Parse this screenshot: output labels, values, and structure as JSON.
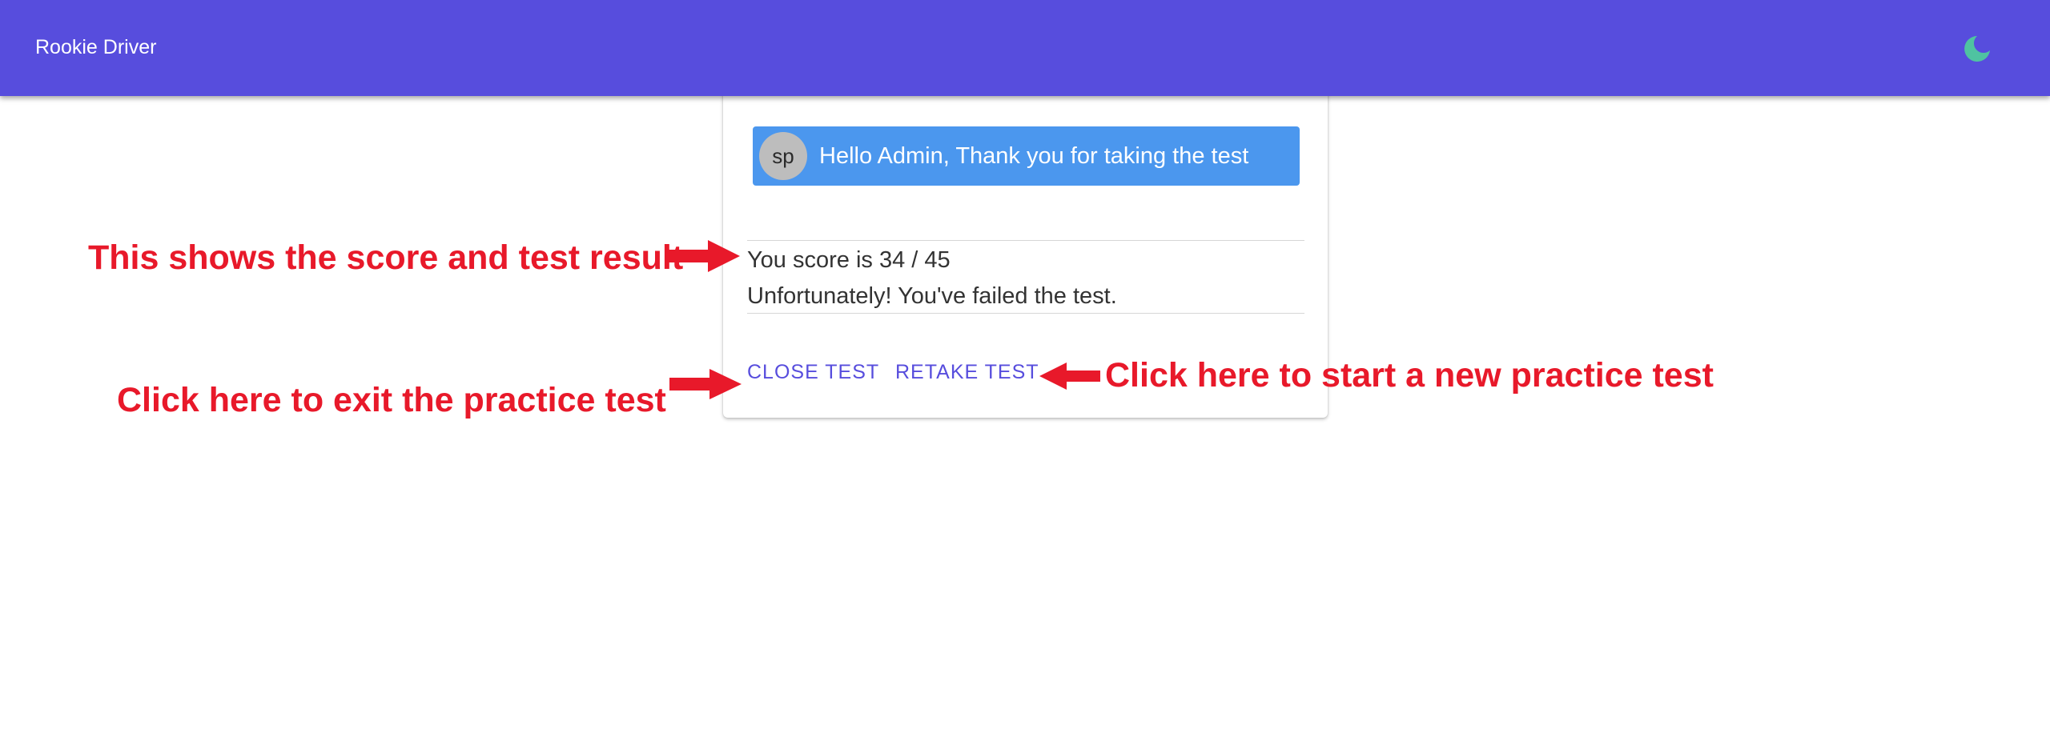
{
  "header": {
    "title": "Rookie Driver",
    "theme_icon": "moon-icon",
    "background_color": "#574ddd",
    "theme_icon_color": "#4fc3a1"
  },
  "result_card": {
    "avatar_initials": "sp",
    "greeting": "Hello Admin, Thank you for taking the test",
    "chip_color": "#4b97ee",
    "score_text": "You score is 34 / 45",
    "result_text": "Unfortunately! You've failed the test.",
    "close_button_label": "CLOSE TEST",
    "retake_button_label": "RETAKE TEST",
    "button_color": "#574ddd"
  },
  "annotations": {
    "color": "#e8192a",
    "arrow_icon": "red-arrow-icon",
    "score_note": "This shows the score and test result",
    "exit_note": "Click here to exit the practice test",
    "new_test_note": "Click here to start a new practice test"
  }
}
